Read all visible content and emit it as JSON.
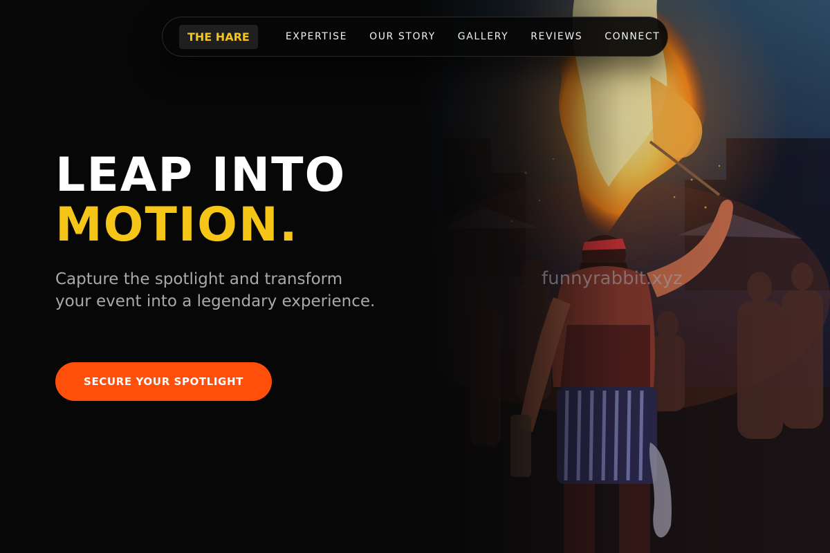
{
  "nav": {
    "brand": "THE HARE",
    "links": [
      "EXPERTISE",
      "OUR STORY",
      "GALLERY",
      "REVIEWS",
      "CONNECT"
    ]
  },
  "hero": {
    "headline_line1": "LEAP INTO",
    "headline_line2": "MOTION.",
    "subtext": "Capture the spotlight and transform your event into a legendary experience.",
    "cta_label": "SECURE YOUR SPOTLIGHT",
    "image_subject": "fire-breather performing at night crowd"
  },
  "watermark": "funnyrabbit.xyz",
  "colors": {
    "background": "#070707",
    "accent_yellow": "#f5c518",
    "cta_orange": "#ff4f0a",
    "subtext_gray": "#a9a9a9"
  }
}
